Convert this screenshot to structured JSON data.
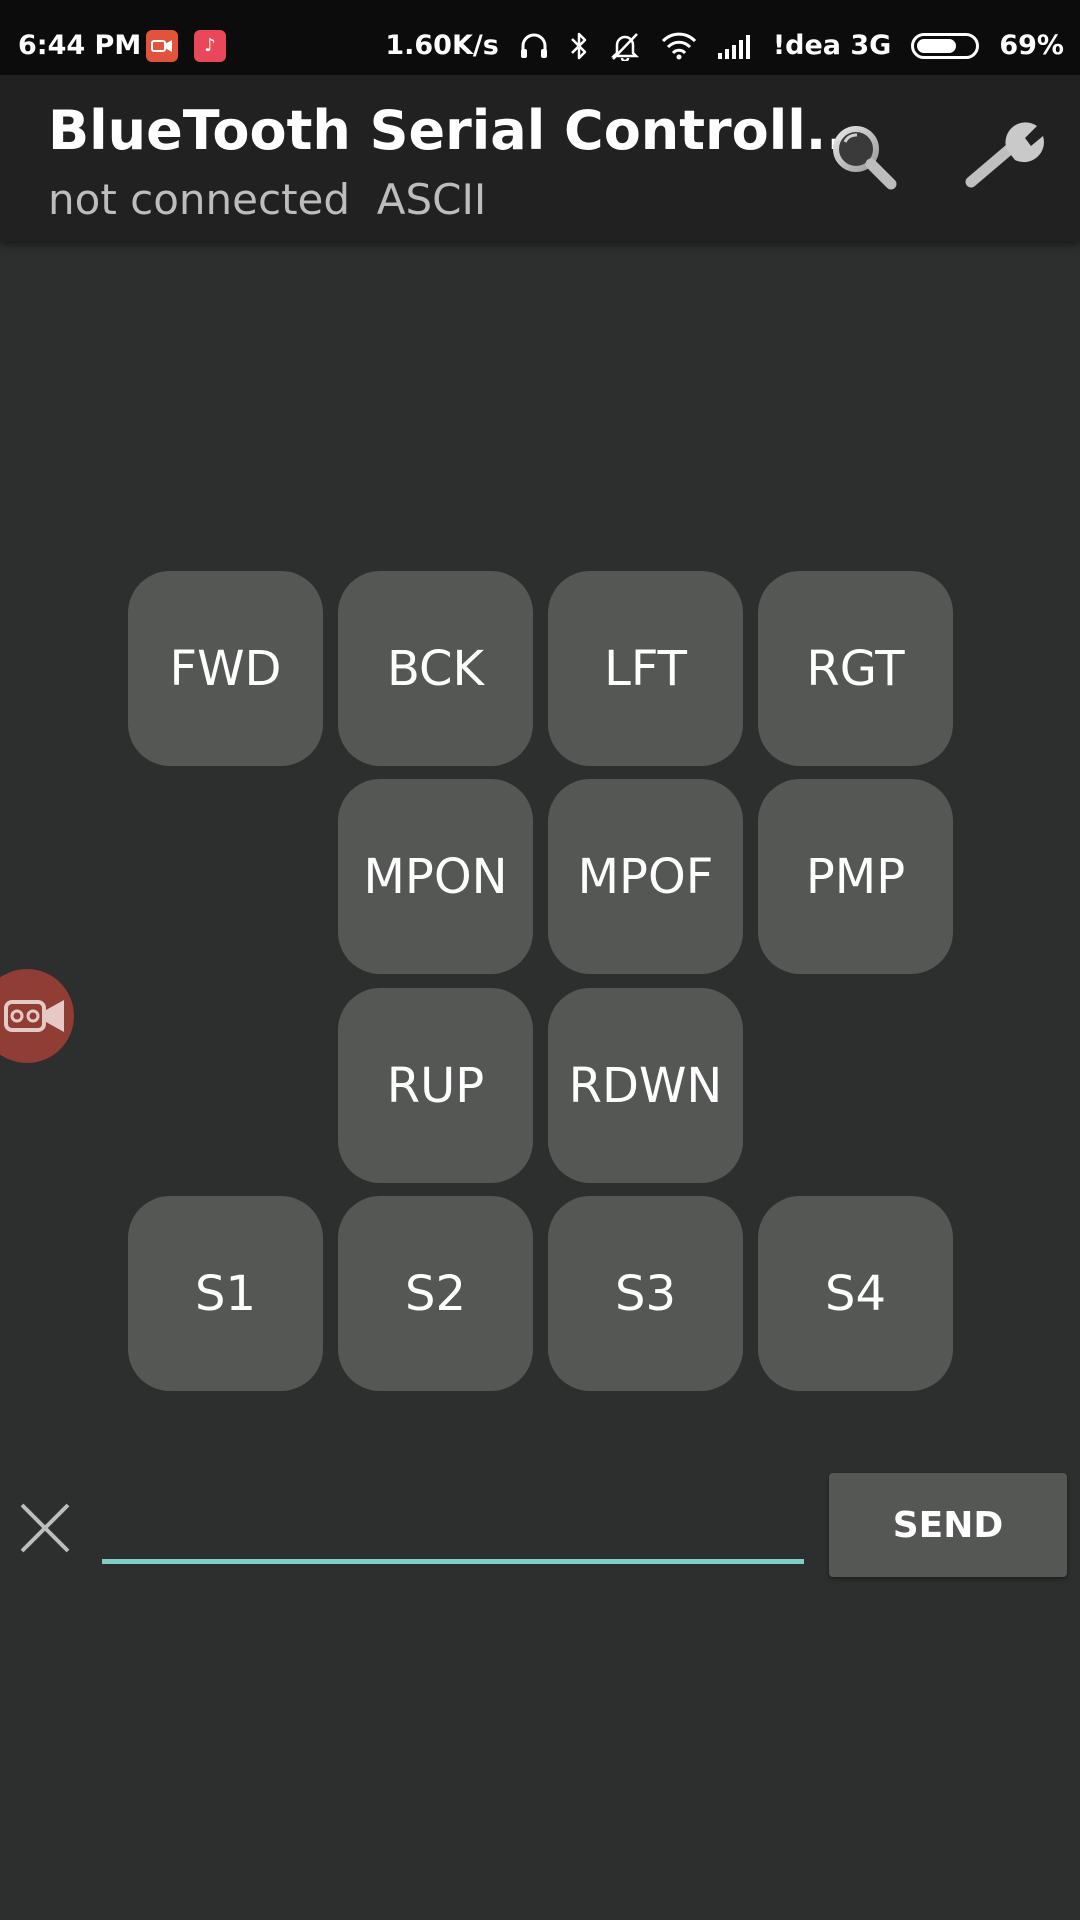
{
  "status_bar": {
    "time": "6:44 PM",
    "network_speed": "1.60K/s",
    "carrier": "!dea 3G",
    "battery_percent": "69%",
    "battery_level": 0.69,
    "app_icons": [
      "screen-recorder-icon",
      "tiktok-icon"
    ],
    "indicators": [
      "headphones-icon",
      "bluetooth-icon",
      "notifications-off-icon",
      "wifi-icon",
      "signal-icon"
    ]
  },
  "action_bar": {
    "title": "BlueTooth Serial Controll...",
    "subtitle": "not connected  ASCII",
    "actions": [
      "search-icon",
      "wrench-icon"
    ]
  },
  "buttons": {
    "row1": [
      "FWD",
      "BCK",
      "LFT",
      "RGT"
    ],
    "row2": [
      "MPON",
      "MPOF",
      "PMP"
    ],
    "row3": [
      "RUP",
      "RDWN"
    ],
    "row4": [
      "S1",
      "S2",
      "S3",
      "S4"
    ]
  },
  "input": {
    "value": "",
    "placeholder": "",
    "clear_icon": "close-icon",
    "send_label": "SEND"
  },
  "colors": {
    "background": "#2d2f2e",
    "action_bar": "#212121",
    "button": "#555755",
    "input_underline": "#7fcdc4",
    "floating_recorder": "#8f3d35"
  }
}
